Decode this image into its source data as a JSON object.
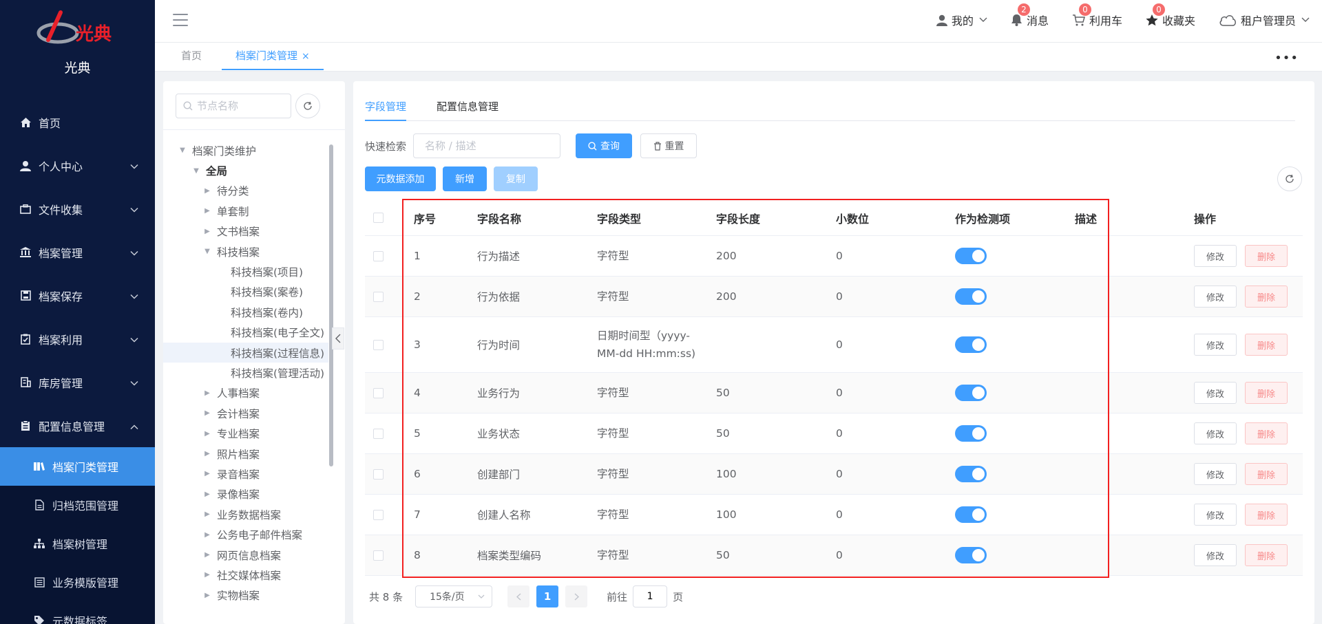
{
  "sidebar": {
    "logo_text": "光典",
    "logo_mark_text": "光典",
    "menu": [
      {
        "label": "首页",
        "icon": "home-icon"
      },
      {
        "label": "个人中心",
        "icon": "user-icon"
      },
      {
        "label": "文件收集",
        "icon": "briefcase-icon"
      },
      {
        "label": "档案管理",
        "icon": "bank-icon"
      },
      {
        "label": "档案保存",
        "icon": "save-icon"
      },
      {
        "label": "档案利用",
        "icon": "clipboard-check-icon"
      },
      {
        "label": "库房管理",
        "icon": "building-icon"
      },
      {
        "label": "配置信息管理",
        "icon": "clipboard-icon"
      }
    ],
    "submenu": [
      {
        "label": "档案门类管理",
        "icon": "books-icon"
      },
      {
        "label": "归档范围管理",
        "icon": "document-icon"
      },
      {
        "label": "档案树管理",
        "icon": "sitemap-icon"
      },
      {
        "label": "业务模版管理",
        "icon": "template-icon"
      },
      {
        "label": "元数据标签",
        "icon": "tag-icon"
      }
    ]
  },
  "header": {
    "mine": "我的",
    "messages": "消息",
    "messages_badge": "2",
    "cart": "利用车",
    "cart_badge": "0",
    "favorites": "收藏夹",
    "favorites_badge": "0",
    "user": "租户管理员"
  },
  "tabs": [
    {
      "label": "首页"
    },
    {
      "label": "档案门类管理",
      "close": "×"
    }
  ],
  "more": "•••",
  "tree": {
    "placeholder": "节点名称",
    "nodes": [
      {
        "label": "档案门类维护",
        "level": 0,
        "caret": "▼"
      },
      {
        "label": "全局",
        "level": 1,
        "caret": "▼"
      },
      {
        "label": "待分类",
        "level": 2,
        "caret": "▶"
      },
      {
        "label": "单套制",
        "level": 2,
        "caret": "▶"
      },
      {
        "label": "文书档案",
        "level": 2,
        "caret": "▶"
      },
      {
        "label": "科技档案",
        "level": 2,
        "caret": "▼"
      },
      {
        "label": "科技档案(项目)",
        "level": 3,
        "caret": ""
      },
      {
        "label": "科技档案(案卷)",
        "level": 3,
        "caret": ""
      },
      {
        "label": "科技档案(卷内)",
        "level": 3,
        "caret": ""
      },
      {
        "label": "科技档案(电子全文)",
        "level": 3,
        "caret": ""
      },
      {
        "label": "科技档案(过程信息)",
        "level": 3,
        "caret": ""
      },
      {
        "label": "科技档案(管理活动)",
        "level": 3,
        "caret": ""
      },
      {
        "label": "人事档案",
        "level": 2,
        "caret": "▶"
      },
      {
        "label": "会计档案",
        "level": 2,
        "caret": "▶"
      },
      {
        "label": "专业档案",
        "level": 2,
        "caret": "▶"
      },
      {
        "label": "照片档案",
        "level": 2,
        "caret": "▶"
      },
      {
        "label": "录音档案",
        "level": 2,
        "caret": "▶"
      },
      {
        "label": "录像档案",
        "level": 2,
        "caret": "▶"
      },
      {
        "label": "业务数据档案",
        "level": 2,
        "caret": "▶"
      },
      {
        "label": "公务电子邮件档案",
        "level": 2,
        "caret": "▶"
      },
      {
        "label": "网页信息档案",
        "level": 2,
        "caret": "▶"
      },
      {
        "label": "社交媒体档案",
        "level": 2,
        "caret": "▶"
      },
      {
        "label": "实物档案",
        "level": 2,
        "caret": "▶"
      }
    ]
  },
  "main": {
    "sub_tabs": [
      "字段管理",
      "配置信息管理"
    ],
    "search_label": "快速检索",
    "search_placeholder": "名称 / 描述",
    "query_btn": "查询",
    "reset_btn": "重置",
    "meta_add_btn": "元数据添加",
    "add_btn": "新增",
    "copy_btn": "复制",
    "columns": [
      "序号",
      "字段名称",
      "字段类型",
      "字段长度",
      "小数位",
      "作为检测项",
      "描述",
      "操作"
    ],
    "edit_label": "修改",
    "delete_label": "删除",
    "rows": [
      {
        "no": "1",
        "name": "行为描述",
        "type": "字符型",
        "length": "200",
        "decimal": "0",
        "desc": ""
      },
      {
        "no": "2",
        "name": "行为依据",
        "type": "字符型",
        "length": "200",
        "decimal": "0",
        "desc": ""
      },
      {
        "no": "3",
        "name": "行为时间",
        "type": "日期时间型（yyyy-MM-dd HH:mm:ss)",
        "length": "",
        "decimal": "0",
        "desc": ""
      },
      {
        "no": "4",
        "name": "业务行为",
        "type": "字符型",
        "length": "50",
        "decimal": "0",
        "desc": ""
      },
      {
        "no": "5",
        "name": "业务状态",
        "type": "字符型",
        "length": "50",
        "decimal": "0",
        "desc": ""
      },
      {
        "no": "6",
        "name": "创建部门",
        "type": "字符型",
        "length": "100",
        "decimal": "0",
        "desc": ""
      },
      {
        "no": "7",
        "name": "创建人名称",
        "type": "字符型",
        "length": "100",
        "decimal": "0",
        "desc": ""
      },
      {
        "no": "8",
        "name": "档案类型编码",
        "type": "字符型",
        "length": "50",
        "decimal": "0",
        "desc": ""
      }
    ],
    "pager": {
      "total": "共 8 条",
      "page_size": "15条/页",
      "current": "1",
      "goto_prefix": "前往",
      "goto_value": "1",
      "goto_suffix": "页"
    }
  }
}
